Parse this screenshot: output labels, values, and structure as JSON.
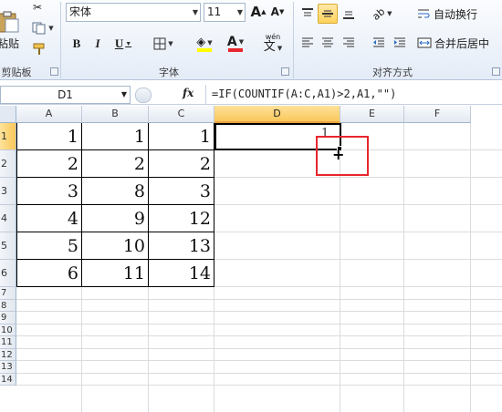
{
  "ribbon": {
    "clipboard": {
      "paste_label": "粘贴",
      "group_label": "剪贴板"
    },
    "font": {
      "name": "宋体",
      "size": "11",
      "grow_label": "A",
      "shrink_label": "A",
      "bold": "B",
      "italic": "I",
      "underline": "U",
      "font_color_letter": "A",
      "phonetic_label": "wén",
      "group_label": "字体"
    },
    "alignment": {
      "wrap_label": "自动换行",
      "merge_label": "合并后居中",
      "group_label": "对齐方式"
    }
  },
  "formula_bar": {
    "name_box": "D1",
    "fx_label": "fx",
    "formula": "=IF(COUNTIF(A:C,A1)>2,A1,\"\")"
  },
  "sheet": {
    "columns": [
      "A",
      "B",
      "C",
      "D",
      "E",
      "F"
    ],
    "selected_column": "D",
    "row_numbers": [
      "1",
      "2",
      "3",
      "4",
      "5",
      "6",
      "7",
      "8",
      "9",
      "10",
      "11",
      "12",
      "13",
      "14"
    ],
    "rows": [
      [
        "1",
        "1",
        "1"
      ],
      [
        "2",
        "2",
        "2"
      ],
      [
        "3",
        "8",
        "3"
      ],
      [
        "4",
        "9",
        "12"
      ],
      [
        "5",
        "10",
        "13"
      ],
      [
        "6",
        "11",
        "14"
      ]
    ],
    "active_cell_value": "1"
  },
  "colors": {
    "highlight_red": "#e8262d",
    "selected_header": "#f9c85a",
    "font_color_bar": "#e8262d",
    "fill_color_bar": "#ffff00"
  }
}
